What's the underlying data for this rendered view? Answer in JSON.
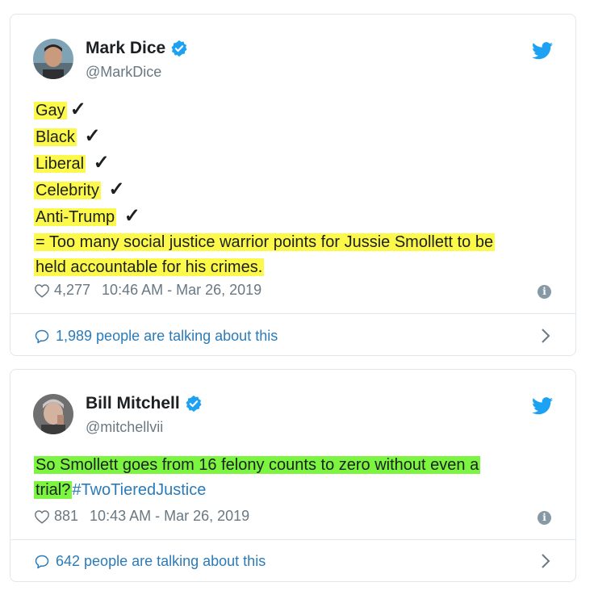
{
  "tweets": [
    {
      "author": {
        "name": "Mark Dice",
        "handle": "@MarkDice"
      },
      "lines": [
        "Gay",
        "Black",
        "Liberal",
        "Celebrity",
        "Anti-Trump"
      ],
      "check_mark": "✓",
      "closing_line_1": "= Too many social justice warrior points for Jussie Smollett to be",
      "closing_line_2": "held accountable for his crimes.",
      "likes": "4,277",
      "timestamp": "10:46 AM - Mar 26, 2019",
      "talking": "1,989 people are talking about this",
      "highlight_color": "#fcf94a"
    },
    {
      "author": {
        "name": "Bill Mitchell",
        "handle": "@mitchellvii"
      },
      "text_part_1": "So Smollett goes from 16 felony counts to zero without even a",
      "text_part_2": "trial?",
      "hashtag": "#TwoTieredJustice",
      "likes": "881",
      "timestamp": "10:43 AM - Mar 26, 2019",
      "talking": "642 people are talking about this",
      "highlight_color": "#7cf541"
    }
  ],
  "colors": {
    "link": "#2b7bb9",
    "verified": "#1da1f2",
    "muted": "#697882"
  },
  "icons": [
    "verified-badge-icon",
    "twitter-bird-icon",
    "heart-icon",
    "info-icon",
    "comment-bubble-icon",
    "chevron-right-icon"
  ]
}
